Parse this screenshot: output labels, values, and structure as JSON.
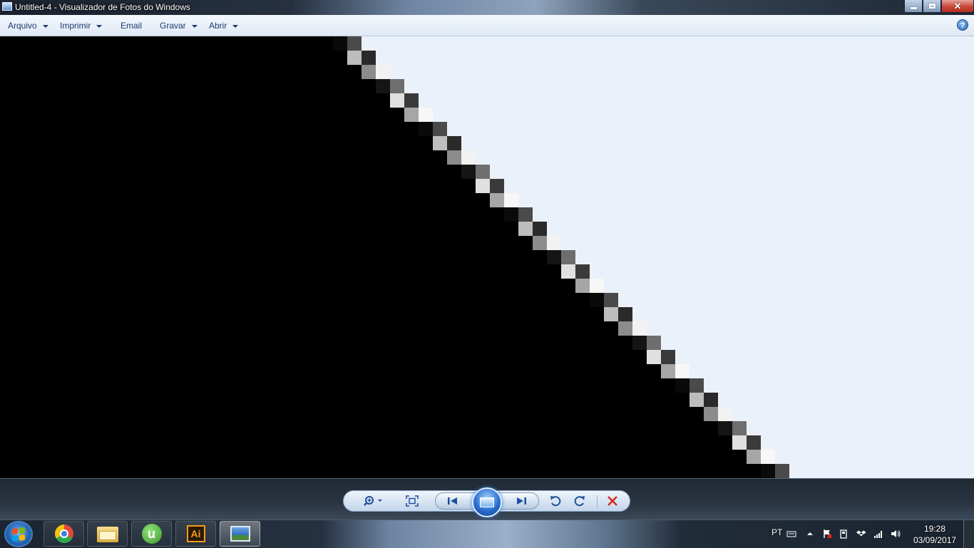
{
  "window": {
    "title": "Untitled-4 - Visualizador de Fotos do Windows"
  },
  "menubar": {
    "items": [
      {
        "label": "Arquivo",
        "has_dropdown": true
      },
      {
        "label": "Imprimir",
        "has_dropdown": true
      },
      {
        "label": "Email",
        "has_dropdown": false
      },
      {
        "label": "Gravar",
        "has_dropdown": true
      },
      {
        "label": "Abrir",
        "has_dropdown": true
      }
    ],
    "help_label": "?"
  },
  "image": {
    "description_colors": {
      "dark": "#000000",
      "light": "#eaf1fa"
    }
  },
  "controls": {
    "icons": [
      "zoom-icon",
      "fit-to-window-icon",
      "previous-icon",
      "slideshow-icon",
      "next-icon",
      "rotate-counterclockwise-icon",
      "rotate-clockwise-icon",
      "delete-icon"
    ],
    "delete_color": "#d42a1e"
  },
  "taskbar": {
    "pinned": [
      "chrome",
      "windows-explorer",
      "utorrent",
      "adobe-illustrator",
      "windows-photo-viewer"
    ],
    "ai_label": "Ai",
    "ut_label": "u",
    "language": "PT",
    "time": "19:28",
    "date": "03/09/2017"
  }
}
